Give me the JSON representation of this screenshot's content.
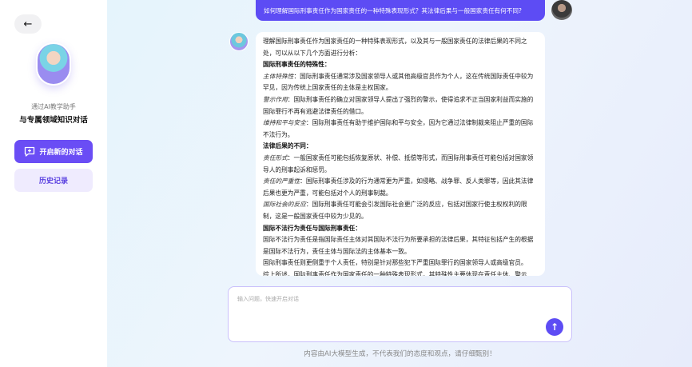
{
  "sidebar": {
    "back_icon": "arrow-left-icon",
    "subtitle": "通过AI教学助手",
    "title": "与专属领域知识对话",
    "new_chat_label": "开启新的对话",
    "history_label": "历史记录"
  },
  "chat": {
    "question": "如何理解国际刑事责任作为国家责任的一种特殊表现形式？其法律后果与一般国家责任有何不同?",
    "answer": [
      {
        "type": "text",
        "text": "理解国际刑事责任作为国家责任的一种特殊表现形式，以及其与一般国家责任的法律后果的不同之处，可以从以下几个方面进行分析："
      },
      {
        "type": "heading",
        "text": "国际刑事责任的特殊性："
      },
      {
        "type": "item",
        "label": "主体特殊性",
        "text": "：国际刑事责任通常涉及国家领导人或其他高级官员作为个人，这在传统国际责任中较为罕见，因为传统上国家责任的主体是主权国家。"
      },
      {
        "type": "item",
        "label": "警示作用",
        "text": "：国际刑事责任的确立对国家领导人提出了强烈的警示，使得追求不正当国家利益而实施的国际罪行不再有逃避法律责任的借口。"
      },
      {
        "type": "item",
        "label": "维持和平与安全",
        "text": "：国际刑事责任有助于维护国际和平与安全，因为它通过法律制裁来阻止严重的国际不法行为。"
      },
      {
        "type": "heading",
        "text": "法律后果的不同："
      },
      {
        "type": "item",
        "label": "责任形式",
        "text": "：一般国家责任可能包括恢复原状、补偿、抵偿等形式，而国际刑事责任可能包括对国家领导人的刑事起诉和惩罚。"
      },
      {
        "type": "item",
        "label": "责任的严重性",
        "text": "：国际刑事责任涉及的行为通常更为严重，如侵略、战争罪、反人类罪等，因此其法律后果也更为严重，可能包括对个人的刑事制裁。"
      },
      {
        "type": "item",
        "label": "国际社会的反应",
        "text": "：国际刑事责任可能会引发国际社会更广泛的反应，包括对国家行使主权权利的限制，这是一般国家责任中较为少见的。"
      },
      {
        "type": "heading",
        "text": "国际不法行为责任与国际刑事责任："
      },
      {
        "type": "text",
        "text": "国际不法行为责任是指国际责任主体对其国际不法行为所要承担的法律后果，其特征包括产生的根据是国际不法行为，责任主体与国际法的主体基本一致。"
      },
      {
        "type": "text",
        "text": "国际刑事责任则更侧重于个人责任，特别是针对那些犯下严重国际罪行的国家领导人或高级官员。"
      },
      {
        "type": "text",
        "text": "综上所述，国际刑事责任作为国家责任的一种特殊表现形式，其特殊性主要体现在责任主体、警示"
      }
    ]
  },
  "input": {
    "placeholder": "输入问题，快速开启对话",
    "value": ""
  },
  "disclaimer": "内容由AI大模型生成，不代表我们的态度和观点，请仔细甄别！",
  "colors": {
    "accent": "#5d4cf4",
    "accent_light": "#efebfe"
  }
}
